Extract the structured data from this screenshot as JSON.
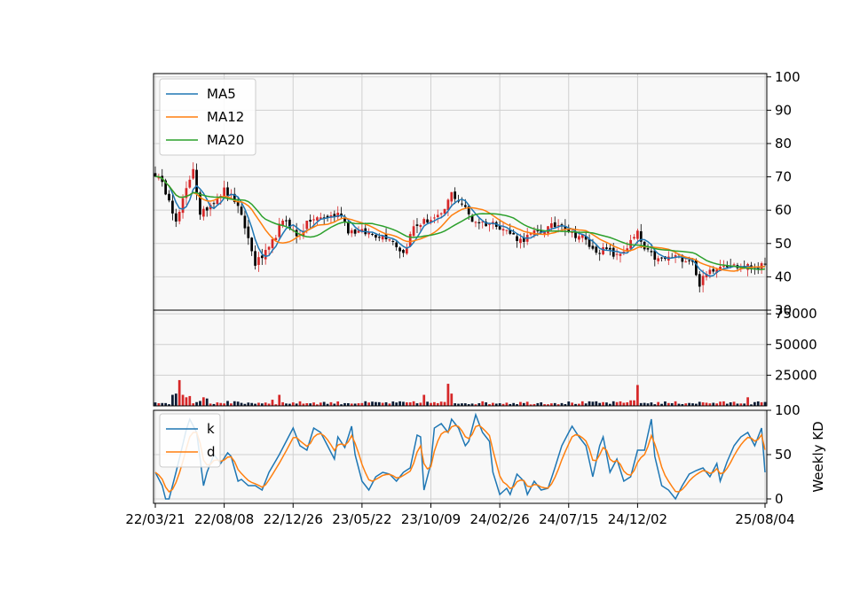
{
  "chart_data": {
    "type": "candlestick",
    "x_tick_labels": [
      "22/03/21",
      "22/08/08",
      "22/12/26",
      "23/05/22",
      "23/10/09",
      "24/02/26",
      "24/07/15",
      "24/12/02",
      "25/08/04"
    ],
    "x_tick_index": [
      0,
      20,
      40,
      60,
      80,
      100,
      120,
      140,
      177
    ],
    "n_weeks": 178,
    "price_panel": {
      "ylim": [
        30,
        101
      ],
      "yticks": [
        "30",
        "40",
        "50",
        "60",
        "70",
        "80",
        "90",
        "100"
      ],
      "ytick_values": [
        30,
        40,
        50,
        60,
        70,
        80,
        90,
        100
      ],
      "up_color": "#d62728",
      "down_color": "#000000",
      "legend_position": "top-left",
      "close_anchors": [
        [
          0,
          71
        ],
        [
          4,
          64
        ],
        [
          6,
          56
        ],
        [
          9,
          66
        ],
        [
          11,
          73
        ],
        [
          13,
          58
        ],
        [
          16,
          62
        ],
        [
          20,
          66
        ],
        [
          23,
          63
        ],
        [
          26,
          55
        ],
        [
          29,
          44
        ],
        [
          31,
          46
        ],
        [
          33,
          48
        ],
        [
          36,
          55
        ],
        [
          38,
          57
        ],
        [
          41,
          52
        ],
        [
          45,
          57
        ],
        [
          50,
          58
        ],
        [
          54,
          59
        ],
        [
          56,
          54
        ],
        [
          62,
          53
        ],
        [
          68,
          52
        ],
        [
          72,
          47
        ],
        [
          75,
          55
        ],
        [
          79,
          57
        ],
        [
          83,
          58
        ],
        [
          86,
          65
        ],
        [
          89,
          62
        ],
        [
          92,
          57
        ],
        [
          96,
          56
        ],
        [
          99,
          56
        ],
        [
          103,
          53
        ],
        [
          106,
          51
        ],
        [
          110,
          53
        ],
        [
          115,
          55
        ],
        [
          118,
          56
        ],
        [
          121,
          53
        ],
        [
          124,
          52
        ],
        [
          127,
          48
        ],
        [
          131,
          48
        ],
        [
          134,
          46
        ],
        [
          137,
          49
        ],
        [
          140,
          53
        ],
        [
          142,
          48
        ],
        [
          146,
          45
        ],
        [
          151,
          46
        ],
        [
          156,
          45
        ],
        [
          157,
          40
        ],
        [
          158,
          38
        ],
        [
          161,
          42
        ],
        [
          165,
          44
        ],
        [
          169,
          43
        ],
        [
          173,
          43
        ],
        [
          177,
          43
        ]
      ],
      "series": [
        {
          "name": "MA5",
          "color": "#1f77b4",
          "window": 5
        },
        {
          "name": "MA12",
          "color": "#ff7f0e",
          "window": 12
        },
        {
          "name": "MA20",
          "color": "#2ca02c",
          "window": 20
        }
      ]
    },
    "volume_panel": {
      "ylim": [
        0,
        78000
      ],
      "yticks": [
        "25000",
        "50000",
        "75000"
      ],
      "ytick_values": [
        25000,
        50000,
        75000
      ],
      "spikes": [
        [
          5,
          9000
        ],
        [
          6,
          10000
        ],
        [
          7,
          21000
        ],
        [
          8,
          9000
        ],
        [
          9,
          7000
        ],
        [
          10,
          8000
        ],
        [
          13,
          4000
        ],
        [
          14,
          7000
        ],
        [
          15,
          6000
        ],
        [
          21,
          4000
        ],
        [
          34,
          5000
        ],
        [
          36,
          9000
        ],
        [
          78,
          9000
        ],
        [
          85,
          18000
        ],
        [
          86,
          10000
        ],
        [
          140,
          17000
        ],
        [
          138,
          4500
        ],
        [
          139,
          4500
        ],
        [
          172,
          7000
        ]
      ]
    },
    "kd_panel": {
      "ylabel": "Weekly KD",
      "ylim": [
        -5,
        100
      ],
      "yticks": [
        "0",
        "50",
        "100"
      ],
      "ytick_values": [
        0,
        50,
        100
      ],
      "legend_position": "top-left",
      "k_anchors": [
        [
          0,
          30
        ],
        [
          2,
          15
        ],
        [
          3,
          0
        ],
        [
          4,
          0
        ],
        [
          6,
          30
        ],
        [
          8,
          62
        ],
        [
          9,
          78
        ],
        [
          10,
          90
        ],
        [
          12,
          75
        ],
        [
          13,
          45
        ],
        [
          14,
          15
        ],
        [
          15,
          30
        ],
        [
          17,
          50
        ],
        [
          19,
          40
        ],
        [
          21,
          52
        ],
        [
          22,
          48
        ],
        [
          24,
          20
        ],
        [
          25,
          22
        ],
        [
          27,
          15
        ],
        [
          29,
          15
        ],
        [
          31,
          10
        ],
        [
          33,
          30
        ],
        [
          36,
          50
        ],
        [
          38,
          65
        ],
        [
          40,
          80
        ],
        [
          42,
          60
        ],
        [
          44,
          55
        ],
        [
          46,
          80
        ],
        [
          48,
          75
        ],
        [
          50,
          60
        ],
        [
          52,
          45
        ],
        [
          53,
          70
        ],
        [
          55,
          58
        ],
        [
          57,
          82
        ],
        [
          58,
          50
        ],
        [
          60,
          20
        ],
        [
          62,
          10
        ],
        [
          64,
          25
        ],
        [
          66,
          30
        ],
        [
          68,
          28
        ],
        [
          70,
          20
        ],
        [
          72,
          30
        ],
        [
          74,
          35
        ],
        [
          76,
          72
        ],
        [
          77,
          70
        ],
        [
          78,
          10
        ],
        [
          80,
          40
        ],
        [
          81,
          80
        ],
        [
          83,
          85
        ],
        [
          85,
          75
        ],
        [
          86,
          90
        ],
        [
          88,
          80
        ],
        [
          90,
          60
        ],
        [
          91,
          65
        ],
        [
          93,
          95
        ],
        [
          95,
          75
        ],
        [
          97,
          65
        ],
        [
          98,
          30
        ],
        [
          100,
          5
        ],
        [
          102,
          12
        ],
        [
          103,
          5
        ],
        [
          105,
          28
        ],
        [
          107,
          20
        ],
        [
          108,
          5
        ],
        [
          110,
          20
        ],
        [
          112,
          10
        ],
        [
          114,
          12
        ],
        [
          116,
          35
        ],
        [
          118,
          60
        ],
        [
          120,
          75
        ],
        [
          121,
          82
        ],
        [
          123,
          70
        ],
        [
          125,
          60
        ],
        [
          127,
          25
        ],
        [
          129,
          60
        ],
        [
          130,
          70
        ],
        [
          132,
          30
        ],
        [
          134,
          45
        ],
        [
          136,
          20
        ],
        [
          138,
          25
        ],
        [
          140,
          55
        ],
        [
          142,
          55
        ],
        [
          144,
          90
        ],
        [
          145,
          48
        ],
        [
          147,
          15
        ],
        [
          149,
          10
        ],
        [
          151,
          0
        ],
        [
          153,
          15
        ],
        [
          155,
          28
        ],
        [
          157,
          32
        ],
        [
          159,
          35
        ],
        [
          161,
          25
        ],
        [
          163,
          40
        ],
        [
          164,
          20
        ],
        [
          166,
          42
        ],
        [
          168,
          60
        ],
        [
          170,
          70
        ],
        [
          172,
          75
        ],
        [
          174,
          60
        ],
        [
          176,
          80
        ],
        [
          177,
          30
        ]
      ],
      "series": [
        {
          "name": "k",
          "color": "#1f77b4"
        },
        {
          "name": "d",
          "color": "#ff7f0e"
        }
      ]
    }
  }
}
